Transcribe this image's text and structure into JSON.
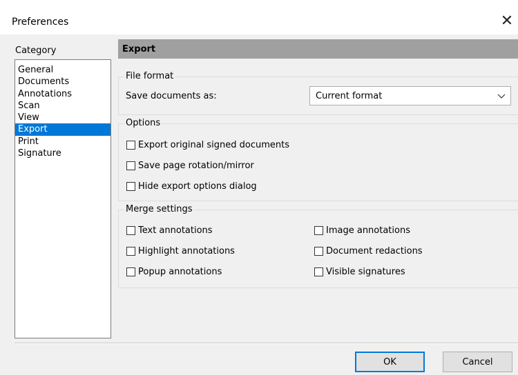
{
  "window": {
    "title": "Preferences",
    "close_icon": "close-icon"
  },
  "category": {
    "label": "Category",
    "items": [
      {
        "label": "General"
      },
      {
        "label": "Documents"
      },
      {
        "label": "Annotations"
      },
      {
        "label": "Scan"
      },
      {
        "label": "View"
      },
      {
        "label": "Export",
        "selected": true
      },
      {
        "label": "Print"
      },
      {
        "label": "Signature"
      }
    ]
  },
  "panel": {
    "header": "Export",
    "file_format": {
      "legend": "File format",
      "save_label": "Save documents as:",
      "save_value": "Current format"
    },
    "options": {
      "legend": "Options",
      "items": [
        {
          "label": "Export original signed documents",
          "checked": false
        },
        {
          "label": "Save page rotation/mirror",
          "checked": false
        },
        {
          "label": "Hide export options dialog",
          "checked": false
        }
      ]
    },
    "merge": {
      "legend": "Merge settings",
      "items": [
        {
          "label": "Text annotations",
          "checked": false
        },
        {
          "label": "Highlight annotations",
          "checked": false
        },
        {
          "label": "Popup annotations",
          "checked": false
        },
        {
          "label": "Image annotations",
          "checked": false
        },
        {
          "label": "Document redactions",
          "checked": false
        },
        {
          "label": "Visible signatures",
          "checked": false
        }
      ]
    }
  },
  "buttons": {
    "ok": "OK",
    "cancel": "Cancel"
  },
  "colors": {
    "selection": "#0078d7",
    "header_bar": "#a0a0a0",
    "dialog_bg": "#f0f0f0"
  }
}
